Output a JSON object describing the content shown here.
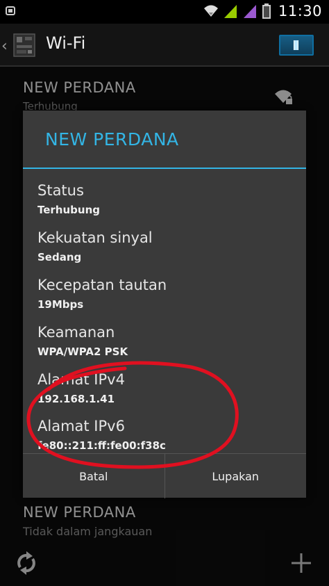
{
  "status_bar": {
    "time": "11:30",
    "icons": [
      "bbm-icon",
      "wifi-icon",
      "signal-icon",
      "signal-icon-2",
      "battery-icon"
    ]
  },
  "action_bar": {
    "title": "Wi-Fi",
    "toggle_state": "on",
    "icons": [
      "back-chevron-icon",
      "settings-app-icon"
    ]
  },
  "background_list": {
    "networks": [
      {
        "name": "NEW PERDANA",
        "status": "Terhubung"
      },
      {
        "name": "NEW PERDANA",
        "status": "Tidak dalam jangkauan"
      }
    ],
    "icons": [
      "wifi-lock-icon",
      "refresh-icon",
      "add-icon"
    ]
  },
  "dialog": {
    "title": "NEW PERDANA",
    "accent_color": "#33b5e5",
    "fields": [
      {
        "label": "Status",
        "value": "Terhubung"
      },
      {
        "label": "Kekuatan sinyal",
        "value": "Sedang"
      },
      {
        "label": "Kecepatan tautan",
        "value": "19Mbps"
      },
      {
        "label": "Keamanan",
        "value": "WPA/WPA2 PSK"
      },
      {
        "label": "Alamat IPv4",
        "value": "192.168.1.41"
      },
      {
        "label": "Alamat IPv6",
        "value": "fe80::211:ff:fe00:f38c"
      }
    ],
    "buttons": {
      "cancel": "Batal",
      "forget": "Lupakan"
    }
  },
  "annotation": {
    "color": "#e01020",
    "shape": "hand-drawn ellipse around IP addresses"
  }
}
